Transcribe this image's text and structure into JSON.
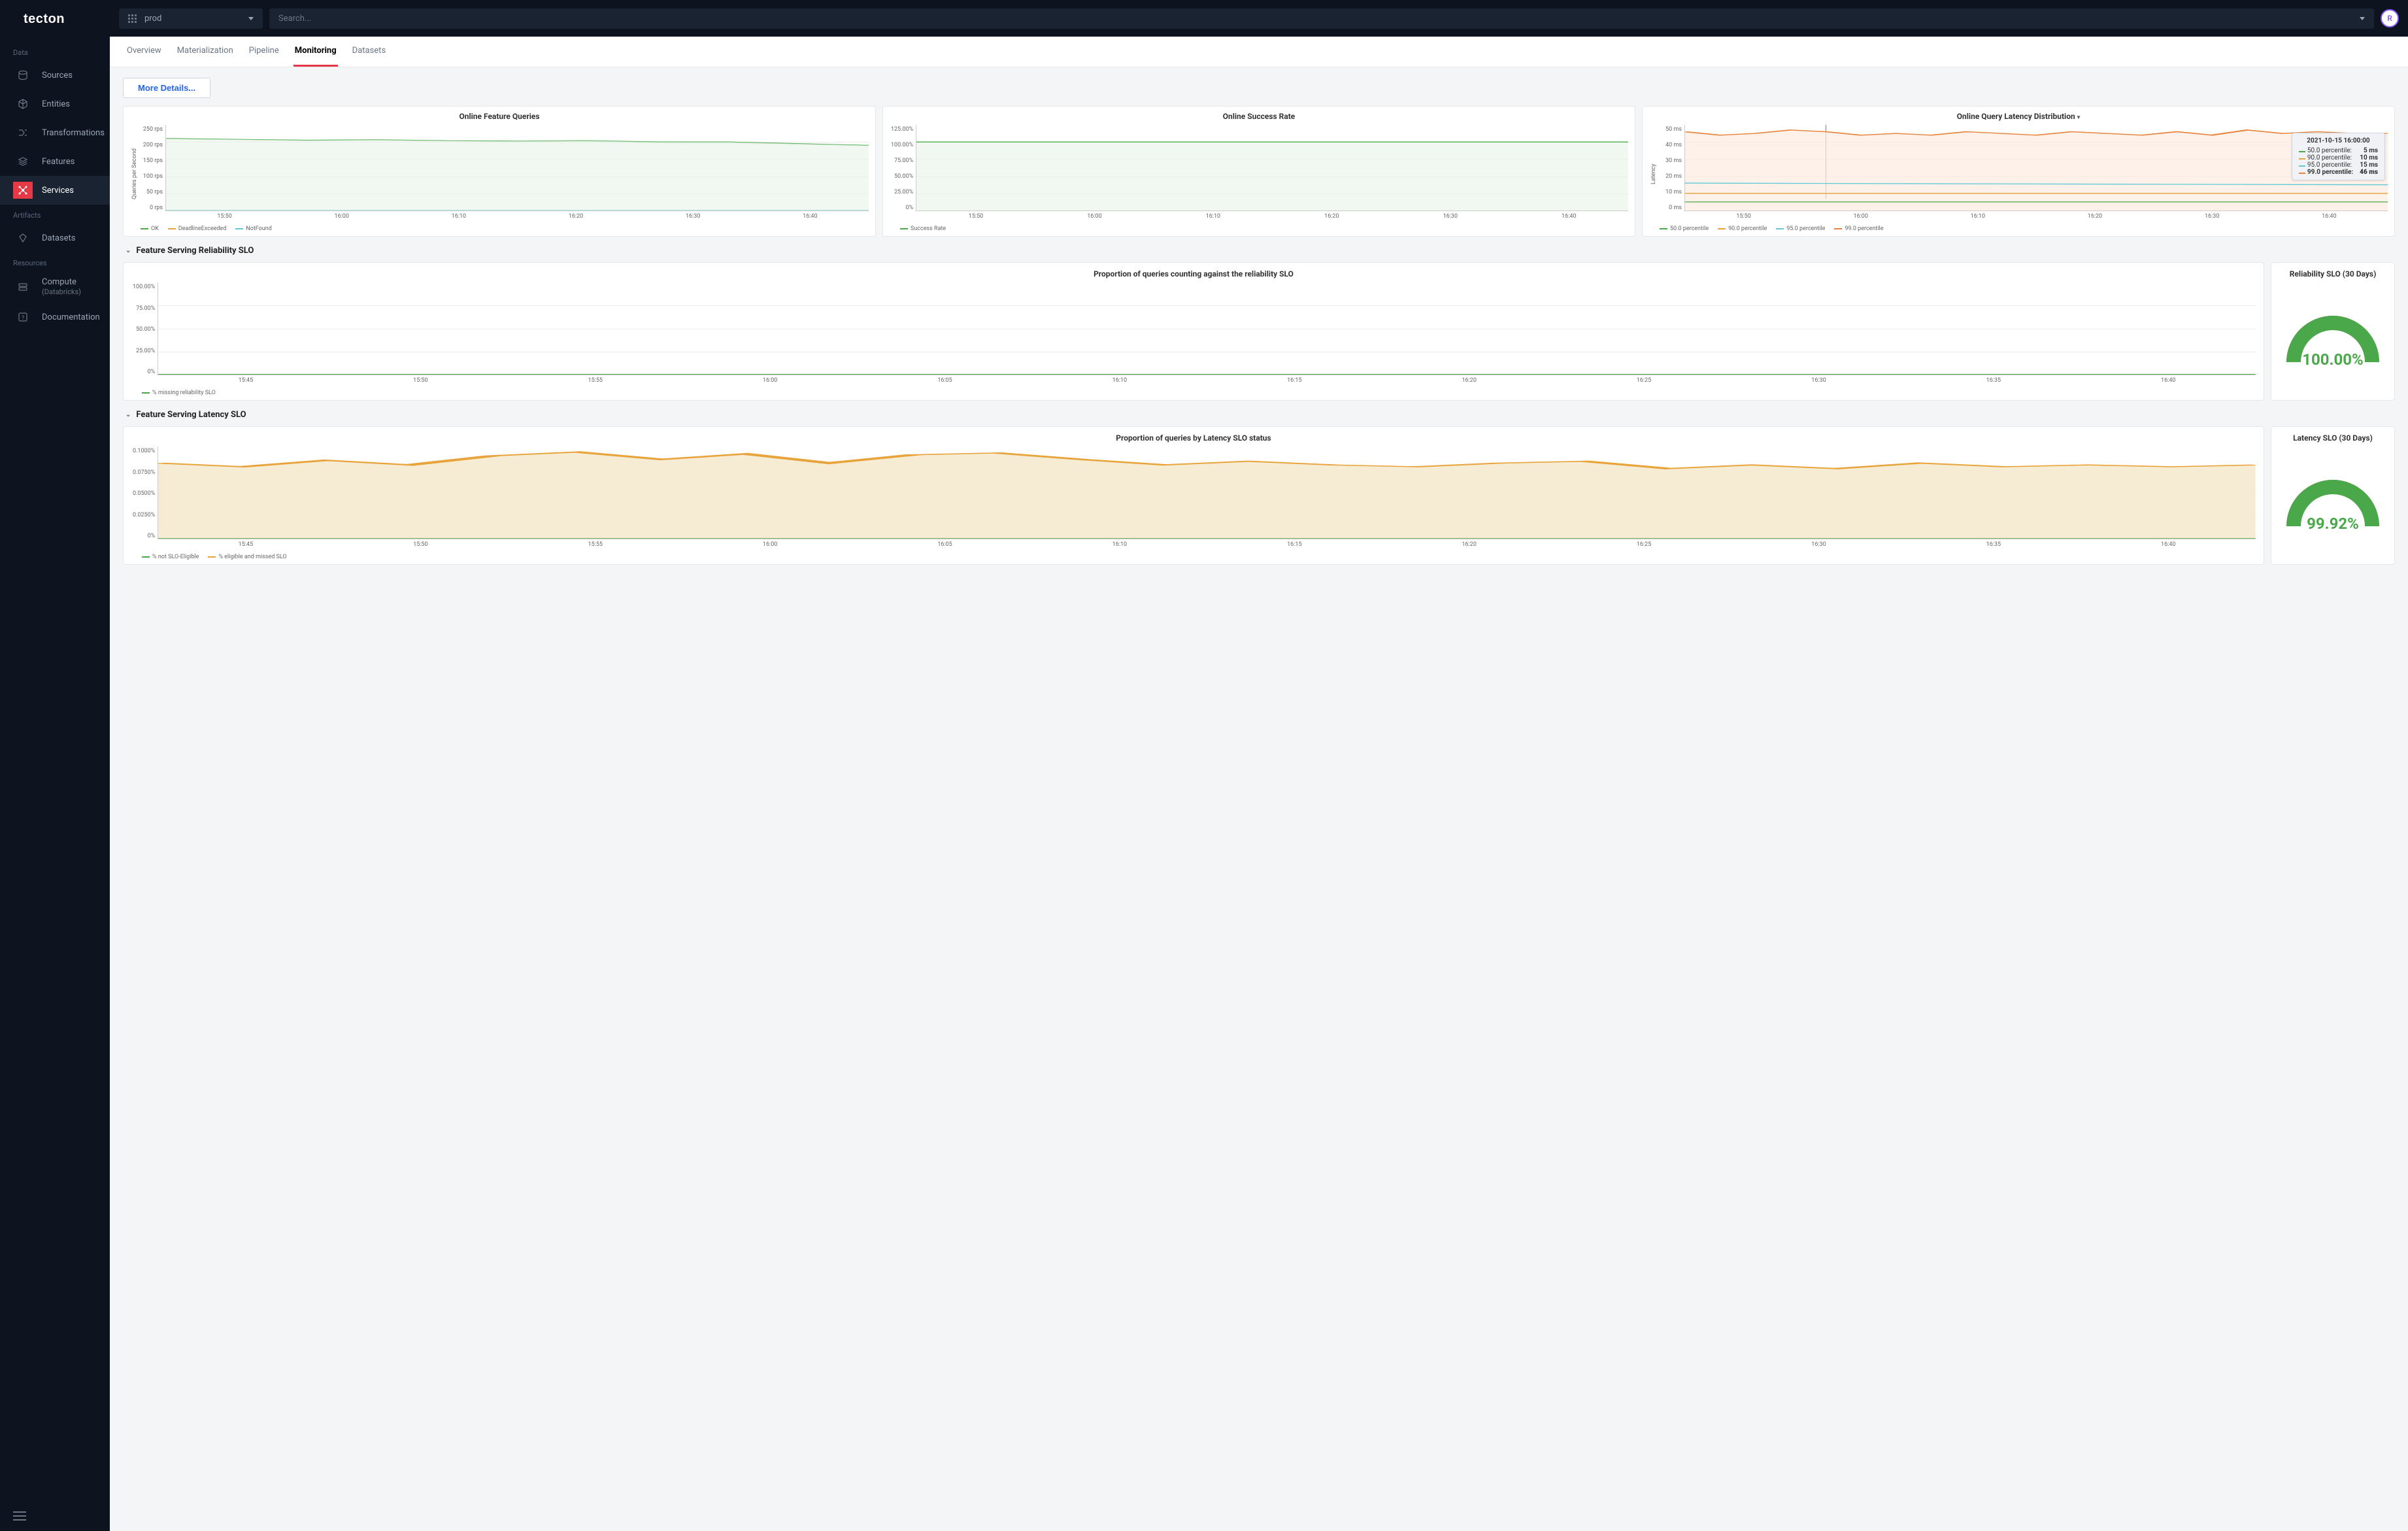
{
  "logo_text": "tecton",
  "env": {
    "label": "prod"
  },
  "search": {
    "placeholder": "Search..."
  },
  "avatar": "R",
  "sidebar": {
    "sections": {
      "data": "Data",
      "artifacts": "Artifacts",
      "resources": "Resources"
    },
    "items": {
      "sources": "Sources",
      "entities": "Entities",
      "transformations": "Transformations",
      "features": "Features",
      "services": "Services",
      "datasets": "Datasets",
      "compute": "Compute",
      "compute_sub": "(Databricks)",
      "documentation": "Documentation"
    }
  },
  "tabs": [
    "Overview",
    "Materialization",
    "Pipeline",
    "Monitoring",
    "Datasets"
  ],
  "active_tab": "Monitoring",
  "more_details": "More Details...",
  "colors": {
    "green": "#4aa84a",
    "orange_dark": "#e8833a",
    "orange": "#e8a33a",
    "cyan": "#5fc9d8",
    "red": "#d9534f"
  },
  "chart1": {
    "title": "Online Feature Queries",
    "ylabel": "Queries per Second",
    "yticks": [
      "250 rps",
      "200 rps",
      "150 rps",
      "100 rps",
      "50 rps",
      "0 rps"
    ],
    "xticks": [
      "15:50",
      "16:00",
      "16:10",
      "16:20",
      "16:30",
      "16:40"
    ],
    "legend": [
      "OK",
      "DeadlineExceeded",
      "NotFound"
    ]
  },
  "chart2": {
    "title": "Online Success Rate",
    "yticks": [
      "125.00%",
      "100.00%",
      "75.00%",
      "50.00%",
      "25.00%",
      "0%"
    ],
    "xticks": [
      "15:50",
      "16:00",
      "16:10",
      "16:20",
      "16:30",
      "16:40"
    ],
    "legend": [
      "Success Rate"
    ]
  },
  "chart3": {
    "title": "Online Query Latency Distribution",
    "ylabel": "Latency",
    "yticks": [
      "50 ms",
      "40 ms",
      "30 ms",
      "20 ms",
      "10 ms",
      "0 ms"
    ],
    "xticks": [
      "15:50",
      "16:00",
      "16:10",
      "16:20",
      "16:30",
      "16:40"
    ],
    "legend": [
      "50.0 percentile",
      "90.0 percentile",
      "95.0 percentile",
      "99.0 percentile"
    ],
    "tooltip": {
      "title": "2021-10-15 16:00:00",
      "rows": [
        {
          "label": "50.0 percentile:",
          "value": "5 ms"
        },
        {
          "label": "90.0 percentile:",
          "value": "10 ms"
        },
        {
          "label": "95.0 percentile:",
          "value": "15 ms"
        },
        {
          "label": "99.0 percentile:",
          "value": "46 ms"
        }
      ]
    }
  },
  "section1": {
    "title": "Feature Serving Reliability SLO",
    "chart_title": "Proportion of queries counting against the reliability SLO",
    "yticks": [
      "100.00%",
      "75.00%",
      "50.00%",
      "25.00%",
      "0%"
    ],
    "xticks": [
      "15:45",
      "15:50",
      "15:55",
      "16:00",
      "16:05",
      "16:10",
      "16:15",
      "16:20",
      "16:25",
      "16:30",
      "16:35",
      "16:40"
    ],
    "legend": [
      "% missing reliability SLO"
    ],
    "gauge_title": "Reliability SLO (30 Days)",
    "gauge_value": "100.00%"
  },
  "section2": {
    "title": "Feature Serving Latency SLO",
    "chart_title": "Proportion of queries by Latency SLO status",
    "yticks": [
      "0.1000%",
      "0.0750%",
      "0.0500%",
      "0.0250%",
      "0%"
    ],
    "xticks": [
      "15:45",
      "15:50",
      "15:55",
      "16:00",
      "16:05",
      "16:10",
      "16:15",
      "16:20",
      "16:25",
      "16:30",
      "16:35",
      "16:40"
    ],
    "legend": [
      "% not SLO-Eligible",
      "% eligible and missed SLO"
    ],
    "gauge_title": "Latency SLO (30 Days)",
    "gauge_value": "99.92%"
  },
  "chart_data": [
    {
      "type": "line",
      "title": "Online Feature Queries",
      "xlabel": "",
      "ylabel": "Queries per Second",
      "x": [
        "15:50",
        "15:55",
        "16:00",
        "16:05",
        "16:10",
        "16:15",
        "16:20",
        "16:25",
        "16:30",
        "16:35",
        "16:40"
      ],
      "ylim": [
        0,
        250
      ],
      "series": [
        {
          "name": "OK",
          "values": [
            215,
            210,
            207,
            208,
            205,
            203,
            205,
            200,
            200,
            195,
            190
          ]
        },
        {
          "name": "DeadlineExceeded",
          "values": [
            0,
            0,
            0,
            0,
            0,
            0,
            0,
            0,
            0,
            0,
            0
          ]
        },
        {
          "name": "NotFound",
          "values": [
            0,
            0,
            0,
            0,
            0,
            0,
            0,
            0,
            0,
            0,
            0
          ]
        }
      ]
    },
    {
      "type": "line",
      "title": "Online Success Rate",
      "xlabel": "",
      "ylabel": "",
      "x": [
        "15:50",
        "15:55",
        "16:00",
        "16:05",
        "16:10",
        "16:15",
        "16:20",
        "16:25",
        "16:30",
        "16:35",
        "16:40"
      ],
      "ylim": [
        0,
        125
      ],
      "series": [
        {
          "name": "Success Rate",
          "values": [
            100,
            100,
            100,
            100,
            100,
            100,
            100,
            100,
            100,
            100,
            100
          ]
        }
      ]
    },
    {
      "type": "line",
      "title": "Online Query Latency Distribution",
      "xlabel": "",
      "ylabel": "Latency (ms)",
      "x": [
        "15:50",
        "15:55",
        "16:00",
        "16:05",
        "16:10",
        "16:15",
        "16:20",
        "16:25",
        "16:30",
        "16:35",
        "16:40"
      ],
      "ylim": [
        0,
        50
      ],
      "series": [
        {
          "name": "50.0 percentile",
          "values": [
            5,
            5,
            5,
            5,
            5,
            5,
            5,
            5,
            5,
            5,
            5
          ]
        },
        {
          "name": "90.0 percentile",
          "values": [
            10,
            10,
            10,
            10,
            10,
            10,
            10,
            10,
            10,
            10,
            10
          ]
        },
        {
          "name": "95.0 percentile",
          "values": [
            16,
            15,
            15,
            15,
            15,
            15,
            15,
            15,
            15,
            15,
            15
          ]
        },
        {
          "name": "99.0 percentile",
          "values": [
            45,
            44,
            46,
            45,
            44,
            45,
            44,
            45,
            46,
            45,
            45
          ]
        }
      ]
    },
    {
      "type": "line",
      "title": "Proportion of queries counting against the reliability SLO",
      "xlabel": "",
      "ylabel": "%",
      "x": [
        "15:45",
        "15:50",
        "15:55",
        "16:00",
        "16:05",
        "16:10",
        "16:15",
        "16:20",
        "16:25",
        "16:30",
        "16:35",
        "16:40"
      ],
      "ylim": [
        0,
        100
      ],
      "series": [
        {
          "name": "% missing reliability SLO",
          "values": [
            0,
            0,
            0,
            0,
            0,
            0,
            0,
            0,
            0,
            0,
            0,
            0
          ]
        }
      ]
    },
    {
      "type": "area",
      "title": "Proportion of queries by Latency SLO status",
      "xlabel": "",
      "ylabel": "%",
      "x": [
        "15:45",
        "15:50",
        "15:55",
        "16:00",
        "16:05",
        "16:10",
        "16:15",
        "16:20",
        "16:25",
        "16:30",
        "16:35",
        "16:40"
      ],
      "ylim": [
        0,
        0.1
      ],
      "series": [
        {
          "name": "% not SLO-Eligible",
          "values": [
            0,
            0,
            0,
            0,
            0,
            0,
            0,
            0,
            0,
            0,
            0,
            0
          ]
        },
        {
          "name": "% eligible and missed SLO",
          "values": [
            0.082,
            0.085,
            0.09,
            0.094,
            0.088,
            0.091,
            0.085,
            0.08,
            0.082,
            0.078,
            0.08,
            0.08
          ]
        }
      ]
    }
  ]
}
